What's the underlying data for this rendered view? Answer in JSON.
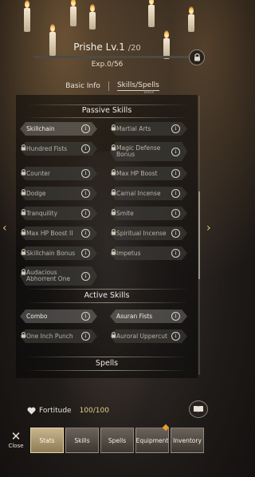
{
  "header": {
    "name": "Prishe",
    "level": "Lv.1",
    "level_max": "/20",
    "exp_label": "Exp.0/56",
    "exp_progress": 0.0
  },
  "tabs": {
    "basic": "Basic Info",
    "skills": "Skills/Spells"
  },
  "peek_text": "Wea",
  "sections": {
    "passive": "Passive Skills",
    "active": "Active Skills",
    "spells": "Spells"
  },
  "passive_skills": [
    {
      "name": "Skillchain",
      "locked": false
    },
    {
      "name": "Martial Arts",
      "locked": true
    },
    {
      "name": "Hundred Fists",
      "locked": true
    },
    {
      "name": "Magic Defense Bonus",
      "locked": true
    },
    {
      "name": "Counter",
      "locked": true
    },
    {
      "name": "Max HP Boost",
      "locked": true
    },
    {
      "name": "Dodge",
      "locked": true
    },
    {
      "name": "Carnal Incense",
      "locked": true
    },
    {
      "name": "Tranquility",
      "locked": true
    },
    {
      "name": "Smite",
      "locked": true
    },
    {
      "name": "Max HP Boost II",
      "locked": true
    },
    {
      "name": "Spiritual Incense",
      "locked": true
    },
    {
      "name": "Skillchain Bonus",
      "locked": true
    },
    {
      "name": "Impetus",
      "locked": true
    },
    {
      "name": "Audacious Abhorrent One",
      "locked": true
    }
  ],
  "active_skills": [
    {
      "name": "Combo",
      "locked": false
    },
    {
      "name": "Asuran Fists",
      "locked": false
    },
    {
      "name": "One Inch Punch",
      "locked": true
    },
    {
      "name": "Auroral Uppercut",
      "locked": true
    }
  ],
  "info_glyph": "i",
  "fortitude": {
    "label": "Fortitude",
    "value": "100/100"
  },
  "close_label": "Close",
  "nav": [
    "Stats",
    "Skills",
    "Spells",
    "Equipment",
    "Inventory"
  ],
  "colors": {
    "accent": "#e89a30",
    "gold": "#e2cf86"
  }
}
